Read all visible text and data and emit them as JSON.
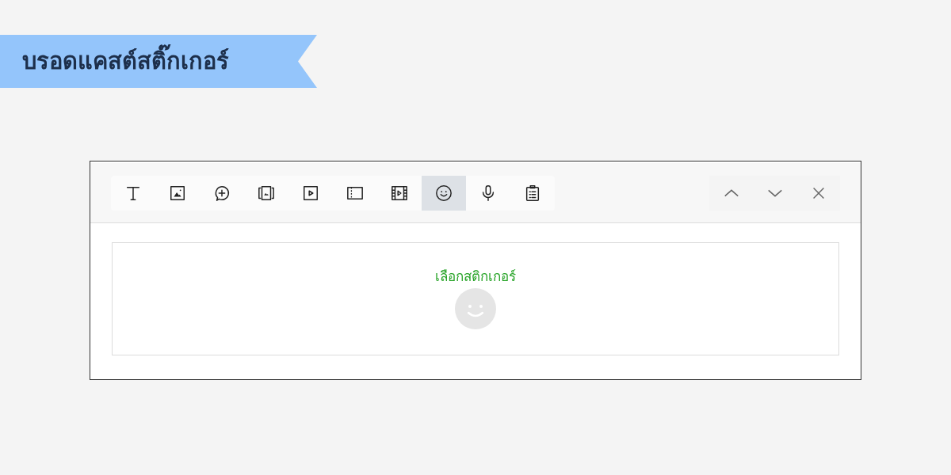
{
  "banner": {
    "title": "บรอดแคสต์สติ๊กเกอร์"
  },
  "toolbar": {
    "tools": [
      {
        "kind": "text",
        "selected": false
      },
      {
        "kind": "image",
        "selected": false
      },
      {
        "kind": "bubble",
        "selected": false
      },
      {
        "kind": "carousel",
        "selected": false
      },
      {
        "kind": "video",
        "selected": false
      },
      {
        "kind": "coupon",
        "selected": false
      },
      {
        "kind": "film",
        "selected": false
      },
      {
        "kind": "sticker",
        "selected": true
      },
      {
        "kind": "mic",
        "selected": false
      },
      {
        "kind": "clipboard",
        "selected": false
      }
    ],
    "nav": [
      {
        "kind": "up"
      },
      {
        "kind": "down"
      },
      {
        "kind": "close"
      }
    ]
  },
  "panel": {
    "label": "เลือกสติกเกอร์"
  }
}
